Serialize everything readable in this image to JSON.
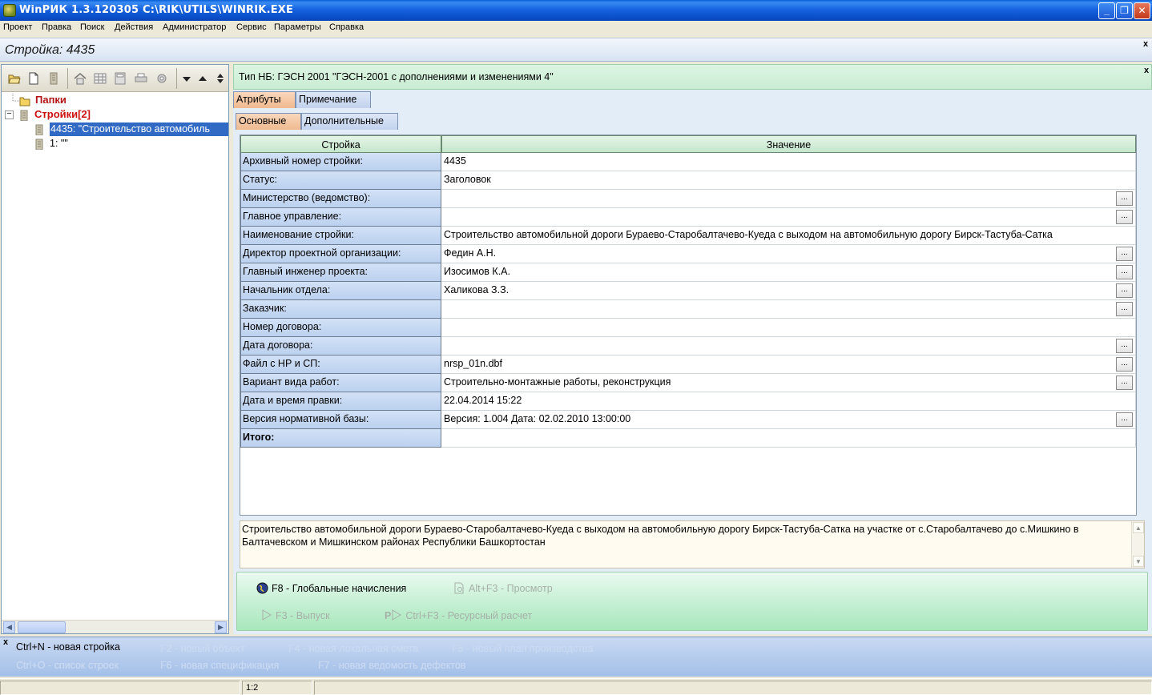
{
  "window": {
    "title": "WinРИК 1.3.120305   C:\\RIK\\UTILS\\WINRIK.EXE",
    "minimize": "_",
    "maximize": "❐",
    "close": "✕"
  },
  "menu": [
    "Проект",
    "Правка",
    "Поиск",
    "Действия",
    "Администратор",
    "Сервис",
    "Параметры",
    "Справка"
  ],
  "project_header": {
    "title": "Стройка: 4435",
    "close": "x"
  },
  "tree": {
    "folders": "Папки",
    "objects": "Стройки[2]",
    "items": [
      "4435: \"Строительство автомобиль",
      "1: \"\""
    ]
  },
  "right": {
    "nb_type": "Тип НБ: ГЭСН 2001 \"ГЭСН-2001 с дополнениями и изменениями 4\"",
    "close": "x",
    "tabs": [
      "Атрибуты",
      "Примечание"
    ],
    "subtabs": [
      "Основные",
      "Дополнительные"
    ],
    "grid_headers": [
      "Стройка",
      "Значение"
    ],
    "rows": [
      {
        "label": "Архивный номер стройки:",
        "value": "4435"
      },
      {
        "label": "Статус:",
        "value": "Заголовок"
      },
      {
        "label": "Министерство (ведомство):",
        "value": ""
      },
      {
        "label": "Главное управление:",
        "value": ""
      },
      {
        "label": "Наименование стройки:",
        "value": "Строительство автомобильной дороги Бураево-Старобалтачево-Куеда с выходом на автомобильную дорогу Бирск-Тастуба-Сатка"
      },
      {
        "label": "Директор проектной организации:",
        "value": "Федин А.Н."
      },
      {
        "label": "Главный инженер проекта:",
        "value": "Изосимов К.А."
      },
      {
        "label": "Начальник отдела:",
        "value": "Халикова З.З."
      },
      {
        "label": "Заказчик:",
        "value": ""
      },
      {
        "label": "Номер договора:",
        "value": ""
      },
      {
        "label": "Дата договора:",
        "value": ""
      },
      {
        "label": "Файл с НР и СП:",
        "value": "nrsp_01n.dbf"
      },
      {
        "label": "Вариант вида работ:",
        "value": "Строительно-монтажные работы, реконструкция"
      },
      {
        "label": "Дата и время правки:",
        "value": "22.04.2014  15:22"
      },
      {
        "label": "Версия нормативной базы:",
        "value": "Версия: 1.004   Дата: 02.02.2010 13:00:00"
      },
      {
        "label": "Итого:",
        "value": ""
      }
    ],
    "ellipsis": "...",
    "note": "Строительство автомобильной дороги Бураево-Старобалтачево-Куеда с выходом на автомобильную дорогу Бирск-Тастуба-Сатка на участке от с.Старобалтачево до с.Мишкино в Балтачевском и Мишкинском районах Республики Башкортостан",
    "actions": {
      "global": "F8 - Глобальные начисления",
      "preview": "Alt+F3 - Просмотр",
      "release": "F3 - Выпуск",
      "resource": "Ctrl+F3 - Ресурсный расчет"
    }
  },
  "hints": {
    "close": "x",
    "new_project": "Ctrl+N - новая стройка",
    "new_object": "F2 - новый объект",
    "new_local": "F4 - новая локальная смета",
    "new_plan": "F5 - новый план производства",
    "list": "Ctrl+O - список строек",
    "new_spec": "F6 - новая спецификация",
    "new_defects": "F7 - новая ведомость дефектов"
  },
  "status": {
    "position": "1:2"
  },
  "colors": {
    "title_bar": "#0a4ec7",
    "tree_selected": "#316ac5",
    "tree_red": "#cc1010",
    "label_cell": "#c5d7f1",
    "action_panel": "#b9ecc8"
  }
}
